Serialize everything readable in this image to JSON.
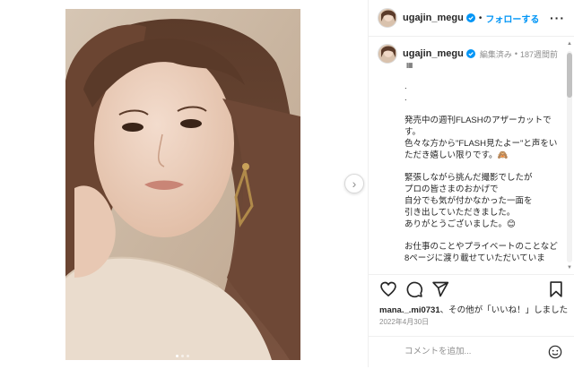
{
  "post": {
    "username": "ugajin_megu",
    "follow_label": "フォローする",
    "separator": "•"
  },
  "caption_meta": {
    "username": "ugajin_megu",
    "edited": "編集済み",
    "dot": "•",
    "age": "187週間前",
    "tag": "▦"
  },
  "caption_text": ".\n.\n\n発売中の週刊FLASHのアザーカットです。\n色々な方から\"FLASH見たよー\"と声をいただき嬉しい限りです。🙈\n\n緊張しながら挑んだ撮影でしたが\nプロの皆さまのおかげで\n自分でも気が付かなかった一面を\n引き出していただきました。\nありがとうございました。😊\n\nお仕事のことやプライベートのことなど\n8ページに渡り載せていただいていま",
  "likes": {
    "name": "mana._.mi0731",
    "rest": "、その他が「いいね！」しました"
  },
  "date": "2022年4月30日",
  "comment": {
    "placeholder": "コメントを追加..."
  },
  "icons": {
    "verified": "verified-badge-icon",
    "more": "more-options-icon",
    "next": "chevron-right-icon",
    "like": "heart-icon",
    "comment": "comment-icon",
    "share": "paper-plane-icon",
    "save": "bookmark-icon",
    "emoji": "emoji-smile-icon"
  },
  "colors": {
    "accent": "#0095f6",
    "text": "#262626",
    "muted": "#8e8e8e"
  }
}
